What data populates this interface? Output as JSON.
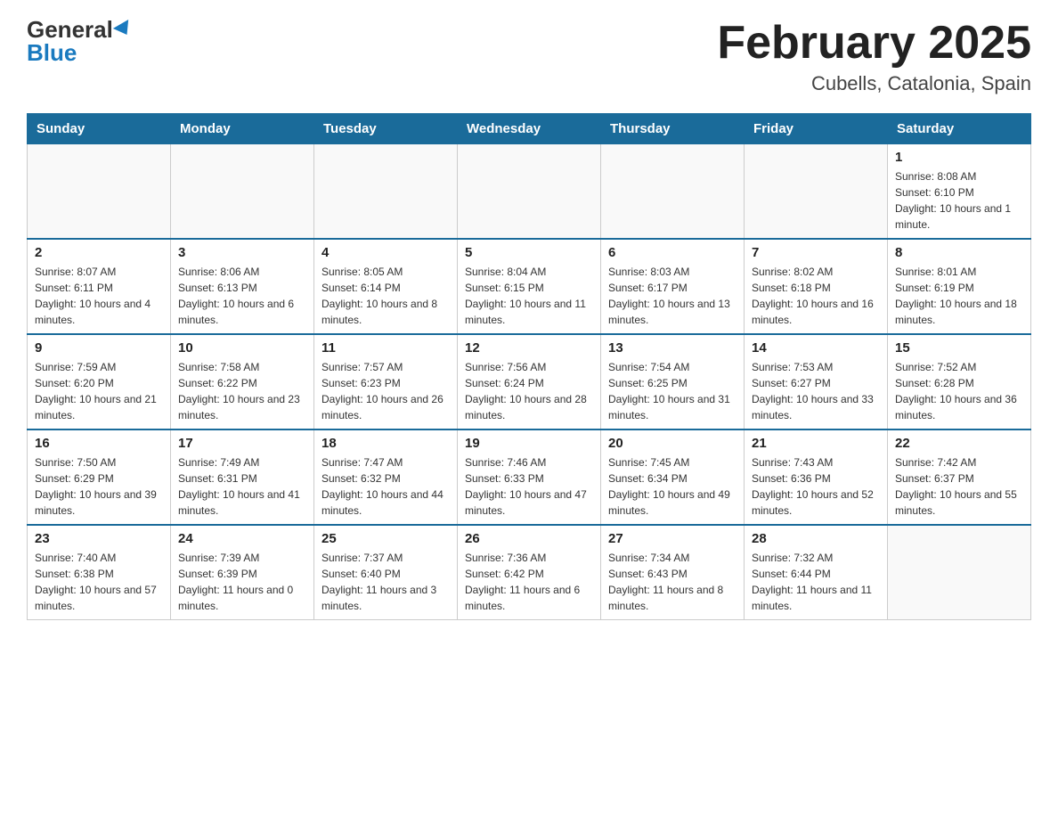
{
  "header": {
    "logo_general": "General",
    "logo_blue": "Blue",
    "month_title": "February 2025",
    "location": "Cubells, Catalonia, Spain"
  },
  "weekdays": [
    "Sunday",
    "Monday",
    "Tuesday",
    "Wednesday",
    "Thursday",
    "Friday",
    "Saturday"
  ],
  "weeks": [
    [
      {
        "day": "",
        "info": ""
      },
      {
        "day": "",
        "info": ""
      },
      {
        "day": "",
        "info": ""
      },
      {
        "day": "",
        "info": ""
      },
      {
        "day": "",
        "info": ""
      },
      {
        "day": "",
        "info": ""
      },
      {
        "day": "1",
        "info": "Sunrise: 8:08 AM\nSunset: 6:10 PM\nDaylight: 10 hours and 1 minute."
      }
    ],
    [
      {
        "day": "2",
        "info": "Sunrise: 8:07 AM\nSunset: 6:11 PM\nDaylight: 10 hours and 4 minutes."
      },
      {
        "day": "3",
        "info": "Sunrise: 8:06 AM\nSunset: 6:13 PM\nDaylight: 10 hours and 6 minutes."
      },
      {
        "day": "4",
        "info": "Sunrise: 8:05 AM\nSunset: 6:14 PM\nDaylight: 10 hours and 8 minutes."
      },
      {
        "day": "5",
        "info": "Sunrise: 8:04 AM\nSunset: 6:15 PM\nDaylight: 10 hours and 11 minutes."
      },
      {
        "day": "6",
        "info": "Sunrise: 8:03 AM\nSunset: 6:17 PM\nDaylight: 10 hours and 13 minutes."
      },
      {
        "day": "7",
        "info": "Sunrise: 8:02 AM\nSunset: 6:18 PM\nDaylight: 10 hours and 16 minutes."
      },
      {
        "day": "8",
        "info": "Sunrise: 8:01 AM\nSunset: 6:19 PM\nDaylight: 10 hours and 18 minutes."
      }
    ],
    [
      {
        "day": "9",
        "info": "Sunrise: 7:59 AM\nSunset: 6:20 PM\nDaylight: 10 hours and 21 minutes."
      },
      {
        "day": "10",
        "info": "Sunrise: 7:58 AM\nSunset: 6:22 PM\nDaylight: 10 hours and 23 minutes."
      },
      {
        "day": "11",
        "info": "Sunrise: 7:57 AM\nSunset: 6:23 PM\nDaylight: 10 hours and 26 minutes."
      },
      {
        "day": "12",
        "info": "Sunrise: 7:56 AM\nSunset: 6:24 PM\nDaylight: 10 hours and 28 minutes."
      },
      {
        "day": "13",
        "info": "Sunrise: 7:54 AM\nSunset: 6:25 PM\nDaylight: 10 hours and 31 minutes."
      },
      {
        "day": "14",
        "info": "Sunrise: 7:53 AM\nSunset: 6:27 PM\nDaylight: 10 hours and 33 minutes."
      },
      {
        "day": "15",
        "info": "Sunrise: 7:52 AM\nSunset: 6:28 PM\nDaylight: 10 hours and 36 minutes."
      }
    ],
    [
      {
        "day": "16",
        "info": "Sunrise: 7:50 AM\nSunset: 6:29 PM\nDaylight: 10 hours and 39 minutes."
      },
      {
        "day": "17",
        "info": "Sunrise: 7:49 AM\nSunset: 6:31 PM\nDaylight: 10 hours and 41 minutes."
      },
      {
        "day": "18",
        "info": "Sunrise: 7:47 AM\nSunset: 6:32 PM\nDaylight: 10 hours and 44 minutes."
      },
      {
        "day": "19",
        "info": "Sunrise: 7:46 AM\nSunset: 6:33 PM\nDaylight: 10 hours and 47 minutes."
      },
      {
        "day": "20",
        "info": "Sunrise: 7:45 AM\nSunset: 6:34 PM\nDaylight: 10 hours and 49 minutes."
      },
      {
        "day": "21",
        "info": "Sunrise: 7:43 AM\nSunset: 6:36 PM\nDaylight: 10 hours and 52 minutes."
      },
      {
        "day": "22",
        "info": "Sunrise: 7:42 AM\nSunset: 6:37 PM\nDaylight: 10 hours and 55 minutes."
      }
    ],
    [
      {
        "day": "23",
        "info": "Sunrise: 7:40 AM\nSunset: 6:38 PM\nDaylight: 10 hours and 57 minutes."
      },
      {
        "day": "24",
        "info": "Sunrise: 7:39 AM\nSunset: 6:39 PM\nDaylight: 11 hours and 0 minutes."
      },
      {
        "day": "25",
        "info": "Sunrise: 7:37 AM\nSunset: 6:40 PM\nDaylight: 11 hours and 3 minutes."
      },
      {
        "day": "26",
        "info": "Sunrise: 7:36 AM\nSunset: 6:42 PM\nDaylight: 11 hours and 6 minutes."
      },
      {
        "day": "27",
        "info": "Sunrise: 7:34 AM\nSunset: 6:43 PM\nDaylight: 11 hours and 8 minutes."
      },
      {
        "day": "28",
        "info": "Sunrise: 7:32 AM\nSunset: 6:44 PM\nDaylight: 11 hours and 11 minutes."
      },
      {
        "day": "",
        "info": ""
      }
    ]
  ]
}
